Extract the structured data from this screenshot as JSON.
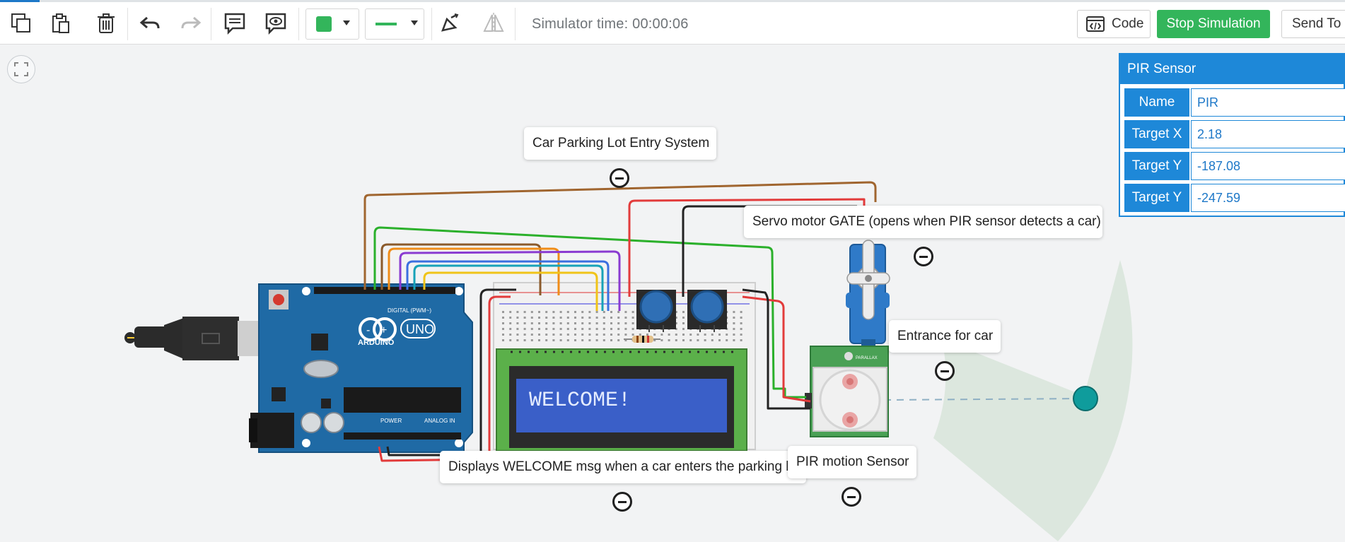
{
  "toolbar": {
    "tools": [
      "copy-icon",
      "paste-icon",
      "delete-icon",
      "undo-icon",
      "redo-icon",
      "notes-icon",
      "visibility-icon"
    ],
    "color_fill": "#33b55b",
    "line_color": "#33b55b",
    "simulator_time_label": "Simulator time: 00:00:06",
    "code_label": "Code",
    "stop_label": "Stop Simulation",
    "send_label": "Send To"
  },
  "annotations": {
    "title_note": "Car Parking Lot Entry System",
    "servo_note": "Servo motor GATE (opens when PIR sensor detects a car)",
    "entrance_note": "Entrance for car",
    "lcd_note": "Displays WELCOME msg when a car enters the parking lot",
    "pir_note": "PIR motion Sensor"
  },
  "components": {
    "lcd_text": "WELCOME!",
    "arduino_brand": "ARDUINO",
    "arduino_model": "UNO",
    "pir_brand": "PARALLAX",
    "arduino_digital_label": "DIGITAL (PWM~)",
    "arduino_power_label": "POWER",
    "arduino_analog_label": "ANALOG IN"
  },
  "inspector": {
    "title": "PIR Sensor",
    "rows": [
      {
        "label": "Name",
        "value": "PIR"
      },
      {
        "label": "Target X",
        "value": "2.18"
      },
      {
        "label": "Target Y",
        "value": "-187.08"
      },
      {
        "label": "Target Y",
        "value": "-247.59"
      }
    ]
  },
  "colors": {
    "accent": "#1e88d8",
    "run_green": "#33b55b",
    "arduino_blue": "#1f6aa5",
    "lcd_blue": "#3a5fc8",
    "pcb_green": "#5bb04a"
  }
}
